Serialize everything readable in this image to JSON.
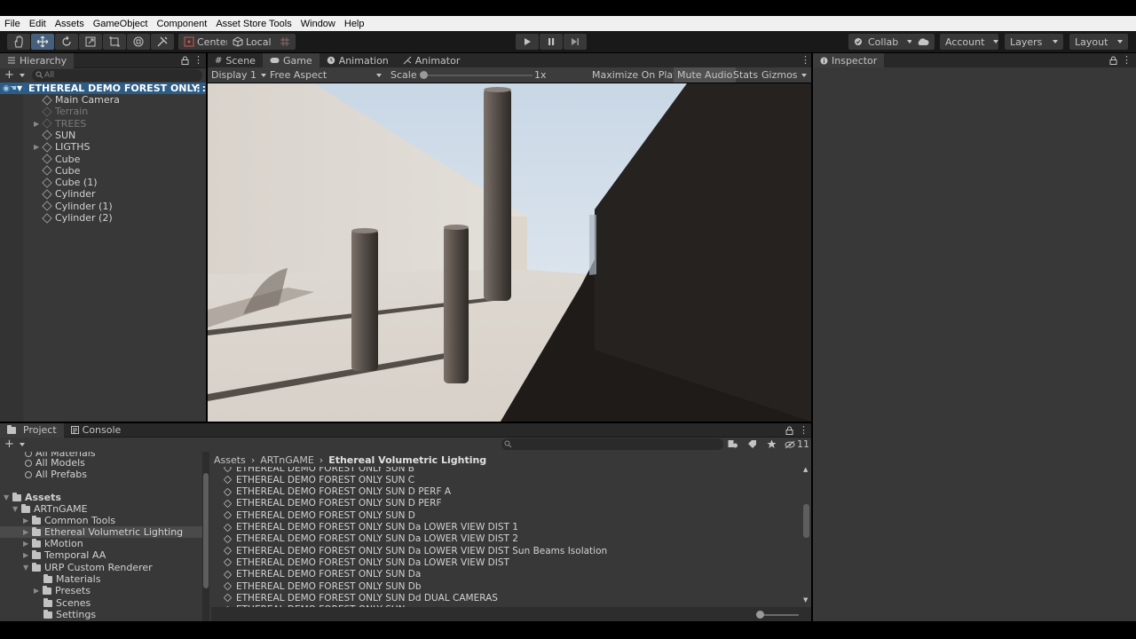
{
  "menu": [
    "File",
    "Edit",
    "Assets",
    "GameObject",
    "Component",
    "Asset Store Tools",
    "Window",
    "Help"
  ],
  "toolbar": {
    "pivot_center": "Center",
    "pivot_local": "Local",
    "collab": "Collab",
    "account": "Account",
    "layers": "Layers",
    "layout": "Layout"
  },
  "hierarchy": {
    "tab": "Hierarchy",
    "search_placeholder": "All",
    "scene": "ETHEREAL DEMO FOREST ONLY :",
    "items": [
      {
        "label": "Main Camera",
        "dim": false,
        "fold": false
      },
      {
        "label": "Terrain",
        "dim": true,
        "fold": false
      },
      {
        "label": "TREES",
        "dim": true,
        "fold": true
      },
      {
        "label": "SUN",
        "dim": false,
        "fold": false
      },
      {
        "label": "LIGTHS",
        "dim": false,
        "fold": true
      },
      {
        "label": "Cube",
        "dim": false,
        "fold": false
      },
      {
        "label": "Cube",
        "dim": false,
        "fold": false
      },
      {
        "label": "Cube (1)",
        "dim": false,
        "fold": false
      },
      {
        "label": "Cylinder",
        "dim": false,
        "fold": false
      },
      {
        "label": "Cylinder (1)",
        "dim": false,
        "fold": false
      },
      {
        "label": "Cylinder (2)",
        "dim": false,
        "fold": false
      }
    ]
  },
  "center_tabs": [
    "Scene",
    "Game",
    "Animation",
    "Animator"
  ],
  "game_toolbar": {
    "display": "Display 1",
    "aspect": "Free Aspect",
    "scale_label": "Scale",
    "scale_value": "1x",
    "maximize": "Maximize On Play",
    "mute": "Mute Audio",
    "stats": "Stats",
    "gizmos": "Gizmos"
  },
  "inspector": {
    "tab": "Inspector"
  },
  "bottom_tabs": [
    "Project",
    "Console"
  ],
  "project": {
    "hidden_count": "11",
    "favorites": [
      "All Materials",
      "All Models",
      "All Prefabs"
    ],
    "tree": [
      {
        "label": "Assets",
        "bold": true
      },
      {
        "label": "ARTnGAME"
      },
      {
        "label": "Common Tools"
      },
      {
        "label": "Ethereal Volumetric Lighting"
      },
      {
        "label": "kMotion"
      },
      {
        "label": "Temporal AA"
      },
      {
        "label": "URP Custom Renderer"
      },
      {
        "label": "Materials"
      },
      {
        "label": "Presets"
      },
      {
        "label": "Scenes"
      },
      {
        "label": "Settings"
      }
    ],
    "breadcrumb": [
      "Assets",
      "ARTnGAME",
      "Ethereal Volumetric Lighting"
    ],
    "files": [
      "ETHEREAL DEMO FOREST ONLY SUN B",
      "ETHEREAL DEMO FOREST ONLY SUN C",
      "ETHEREAL DEMO FOREST ONLY SUN D PERF A",
      "ETHEREAL DEMO FOREST ONLY SUN D PERF",
      "ETHEREAL DEMO FOREST ONLY SUN D",
      "ETHEREAL DEMO FOREST ONLY SUN Da LOWER VIEW DIST 1",
      "ETHEREAL DEMO FOREST ONLY SUN Da LOWER VIEW DIST 2",
      "ETHEREAL DEMO FOREST ONLY SUN Da LOWER VIEW DIST Sun Beams Isolation",
      "ETHEREAL DEMO FOREST ONLY SUN Da LOWER VIEW DIST",
      "ETHEREAL DEMO FOREST ONLY SUN Da",
      "ETHEREAL DEMO FOREST ONLY SUN Db",
      "ETHEREAL DEMO FOREST ONLY SUN Dd DUAL CAMERAS",
      "ETHEREAL DEMO FOREST ONLY SUN..."
    ]
  }
}
